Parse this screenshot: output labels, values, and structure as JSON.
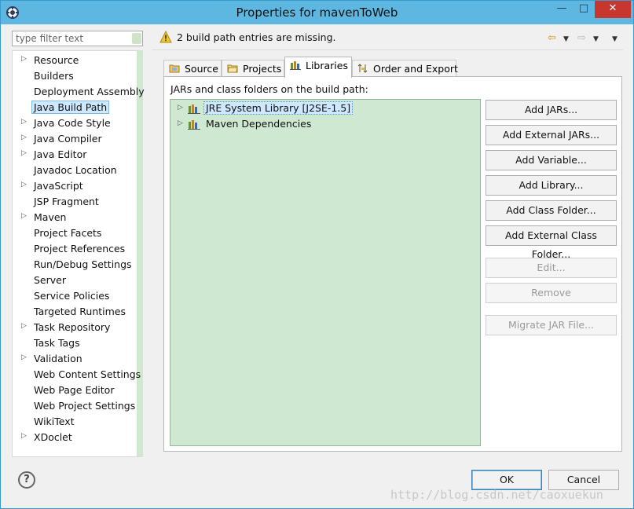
{
  "window": {
    "title": "Properties for mavenToWeb",
    "minimize_glyph": "—",
    "maximize_glyph": "□",
    "close_glyph": "✕"
  },
  "filter": {
    "placeholder": "type filter text"
  },
  "nav": {
    "items": [
      {
        "label": "Resource",
        "expandable": true
      },
      {
        "label": "Builders",
        "expandable": false
      },
      {
        "label": "Deployment Assembly",
        "expandable": false
      },
      {
        "label": "Java Build Path",
        "expandable": false,
        "selected": true
      },
      {
        "label": "Java Code Style",
        "expandable": true
      },
      {
        "label": "Java Compiler",
        "expandable": true
      },
      {
        "label": "Java Editor",
        "expandable": true
      },
      {
        "label": "Javadoc Location",
        "expandable": false
      },
      {
        "label": "JavaScript",
        "expandable": true
      },
      {
        "label": "JSP Fragment",
        "expandable": false
      },
      {
        "label": "Maven",
        "expandable": true
      },
      {
        "label": "Project Facets",
        "expandable": false
      },
      {
        "label": "Project References",
        "expandable": false
      },
      {
        "label": "Run/Debug Settings",
        "expandable": false
      },
      {
        "label": "Server",
        "expandable": false
      },
      {
        "label": "Service Policies",
        "expandable": false
      },
      {
        "label": "Targeted Runtimes",
        "expandable": false
      },
      {
        "label": "Task Repository",
        "expandable": true
      },
      {
        "label": "Task Tags",
        "expandable": false
      },
      {
        "label": "Validation",
        "expandable": true
      },
      {
        "label": "Web Content Settings",
        "expandable": false
      },
      {
        "label": "Web Page Editor",
        "expandable": false
      },
      {
        "label": "Web Project Settings",
        "expandable": false
      },
      {
        "label": "WikiText",
        "expandable": false
      },
      {
        "label": "XDoclet",
        "expandable": true
      }
    ]
  },
  "header": {
    "message": "2 build path entries are missing.",
    "message_icon": "warning-icon",
    "back_glyph": "⇦",
    "forward_glyph": "⇨",
    "dropdown_glyph": "▼"
  },
  "tabs": [
    {
      "label": "Source",
      "icon": "source-folder-icon"
    },
    {
      "label": "Projects",
      "icon": "projects-folder-icon"
    },
    {
      "label": "Libraries",
      "icon": "libraries-icon",
      "active": true
    },
    {
      "label": "Order and Export",
      "icon": "order-export-icon"
    }
  ],
  "libraries": {
    "label": "JARs and class folders on the build path:",
    "entries": [
      {
        "label": "JRE System Library [J2SE-1.5]",
        "selected": true
      },
      {
        "label": "Maven Dependencies",
        "selected": false
      }
    ],
    "buttons": {
      "add_jars": "Add JARs...",
      "add_external_jars": "Add External JARs...",
      "add_variable": "Add Variable...",
      "add_library": "Add Library...",
      "add_class_folder": "Add Class Folder...",
      "add_external_class_folder": "Add External Class Folder...",
      "edit": "Edit...",
      "remove": "Remove",
      "migrate_jar": "Migrate JAR File..."
    }
  },
  "footer": {
    "help_glyph": "?",
    "ok": "OK",
    "cancel": "Cancel"
  },
  "watermark": "http://blog.csdn.net/caoxuekun",
  "colors": {
    "titlebar": "#5db7e0",
    "close": "#c7372f",
    "tree_bg": "#cfe8d1",
    "selection": "#cde8ff"
  }
}
